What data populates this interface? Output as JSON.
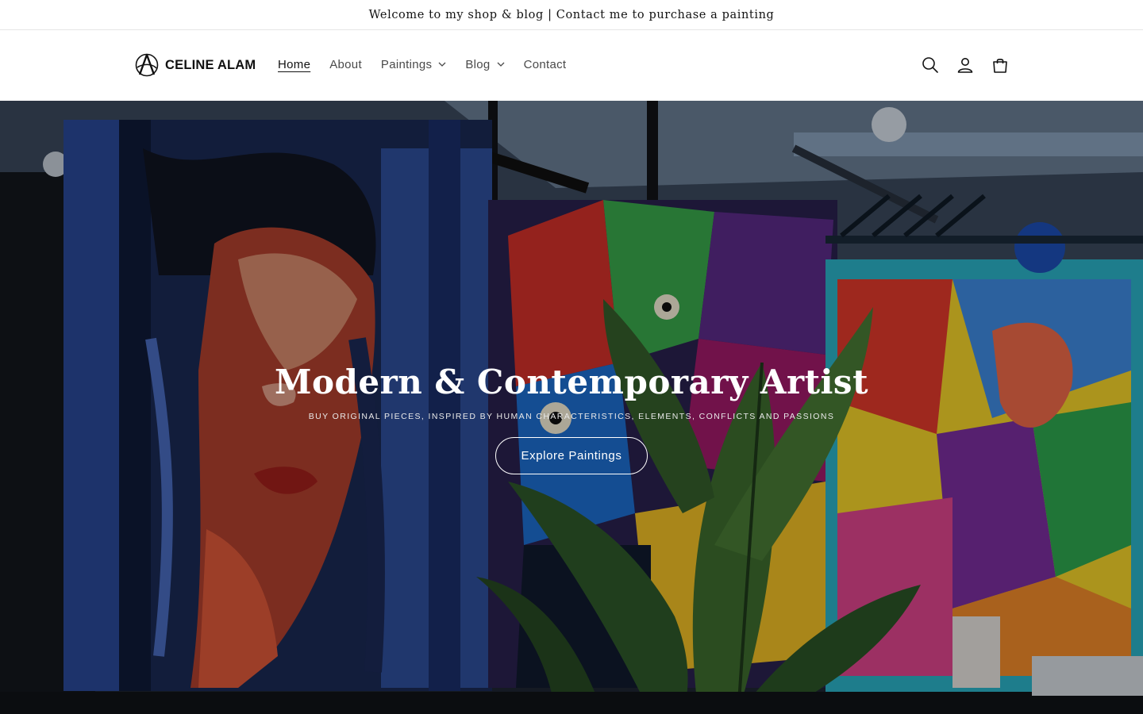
{
  "announcement": {
    "text": "Welcome to my shop & blog | Contact me to purchase a painting"
  },
  "header": {
    "logo_text": "CELINE ALAM",
    "nav": [
      {
        "label": "Home",
        "active": true,
        "dropdown": false
      },
      {
        "label": "About",
        "active": false,
        "dropdown": false
      },
      {
        "label": "Paintings",
        "active": false,
        "dropdown": true
      },
      {
        "label": "Blog",
        "active": false,
        "dropdown": true
      },
      {
        "label": "Contact",
        "active": false,
        "dropdown": false
      }
    ],
    "icons": [
      "search-icon",
      "account-icon",
      "cart-icon"
    ]
  },
  "hero": {
    "title": "Modern & Contemporary Artist",
    "subtitle": "BUY ORIGINAL PIECES, INSPIRED BY HUMAN CHARACTERISTICS, ELEMENTS, CONFLICTS AND PASSIONS",
    "button_label": "Explore Paintings"
  },
  "colors": {
    "text": "#121212",
    "nav_text": "#4a4a4a",
    "hero_text": "#ffffff",
    "divider": "#e6e6e6"
  }
}
